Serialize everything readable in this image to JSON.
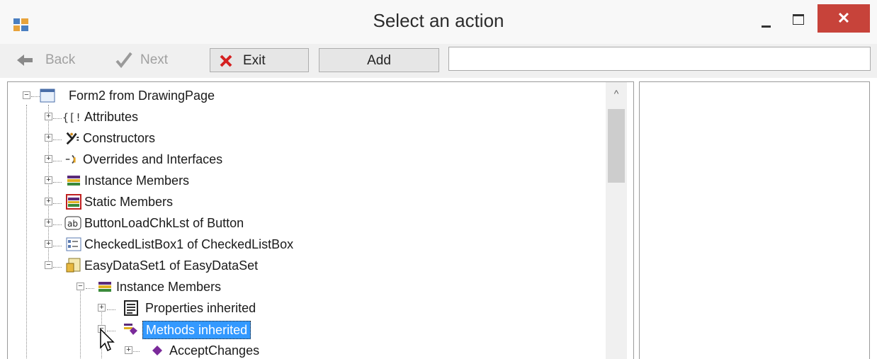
{
  "window": {
    "title": "Select an action",
    "close_glyph": "✕"
  },
  "toolbar": {
    "back_label": "Back",
    "next_label": "Next",
    "exit_label": "Exit",
    "add_label": "Add",
    "search_value": ""
  },
  "scrollbar": {
    "up_glyph": "^"
  },
  "tree": [
    {
      "label": "Form2 from DrawingPage",
      "icon": "form-icon",
      "expander": "−"
    },
    {
      "label": "Attributes",
      "icon": "attributes-icon",
      "expander": "+"
    },
    {
      "label": "Constructors",
      "icon": "constructors-icon",
      "expander": "+"
    },
    {
      "label": "Overrides and Interfaces",
      "icon": "overrides-icon",
      "expander": "+"
    },
    {
      "label": "Instance Members",
      "icon": "instance-members-icon",
      "expander": "+"
    },
    {
      "label": "Static Members",
      "icon": "static-members-icon",
      "expander": "+"
    },
    {
      "label": "ButtonLoadChkLst of Button",
      "icon": "button-ab-icon",
      "expander": "+"
    },
    {
      "label": "CheckedListBox1 of CheckedListBox",
      "icon": "checked-listbox-icon",
      "expander": "+"
    },
    {
      "label": "EasyDataSet1 of EasyDataSet",
      "icon": "dataset-icon",
      "expander": "−"
    },
    {
      "label": "Instance Members",
      "icon": "instance-members-icon",
      "expander": "−"
    },
    {
      "label": "Properties inherited",
      "icon": "properties-icon",
      "expander": "+"
    },
    {
      "label": "Methods inherited",
      "icon": "methods-icon",
      "expander": "−",
      "selected": true
    },
    {
      "label": "AcceptChanges",
      "icon": "method-icon",
      "expander": "+"
    }
  ]
}
